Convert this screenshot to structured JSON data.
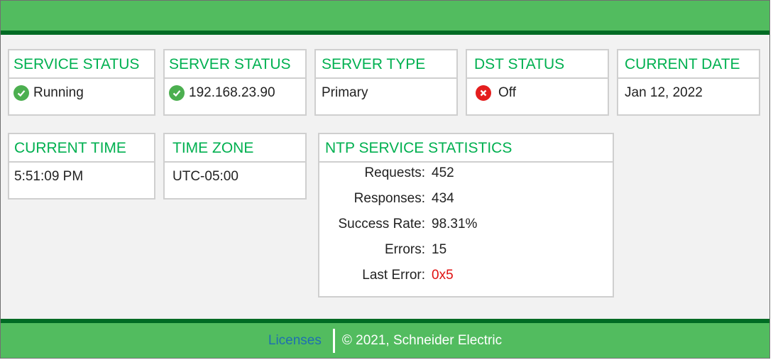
{
  "cards": {
    "service_status": {
      "title": "SERVICE STATUS",
      "value": "Running",
      "icon": "check-circle-icon"
    },
    "server_status": {
      "title": "SERVER STATUS",
      "value": "192.168.23.90",
      "icon": "check-circle-icon"
    },
    "server_type": {
      "title": "SERVER TYPE",
      "value": "Primary"
    },
    "dst_status": {
      "title": "DST STATUS",
      "value": "Off",
      "icon": "x-circle-icon"
    },
    "current_date": {
      "title": "CURRENT DATE",
      "value": "Jan 12, 2022"
    },
    "current_time": {
      "title": "CURRENT TIME",
      "value": "5:51:09 PM"
    },
    "time_zone": {
      "title": "TIME ZONE",
      "value": "UTC-05:00"
    }
  },
  "ntp": {
    "title": "NTP SERVICE STATISTICS",
    "rows": [
      {
        "label": "Requests:",
        "value": "452"
      },
      {
        "label": "Responses:",
        "value": "434"
      },
      {
        "label": "Success Rate:",
        "value": "98.31%"
      },
      {
        "label": "Errors:",
        "value": "15"
      },
      {
        "label": "Last Error:",
        "value": "0x5"
      }
    ]
  },
  "footer": {
    "licenses_label": "Licenses",
    "copyright": "©  2021, Schneider Electric"
  },
  "colors": {
    "accent_green": "#52bc5f",
    "dark_green": "#006b24",
    "title_green": "#00b050",
    "error_red": "#e01010",
    "link_blue": "#1f6fb0"
  }
}
